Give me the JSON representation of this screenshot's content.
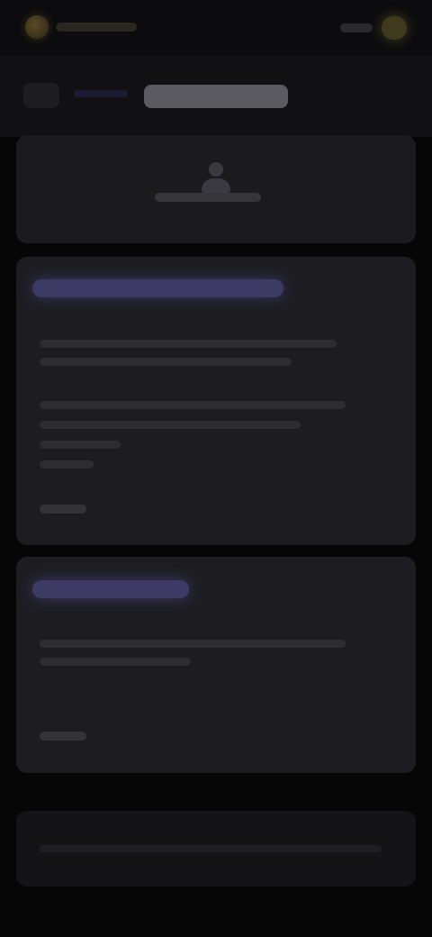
{
  "app": {
    "brand_name": "",
    "nav_link": "",
    "cta_label": ""
  },
  "header": {
    "back_label": "",
    "breadcrumb": "",
    "title": ""
  },
  "profile": {
    "name": ""
  },
  "cards": [
    {
      "heading": "",
      "lines": [
        "",
        "",
        "",
        "",
        "",
        ""
      ],
      "meta": ""
    },
    {
      "heading": "",
      "lines": [
        "",
        ""
      ],
      "meta": ""
    }
  ],
  "footer": {
    "text": ""
  },
  "colors": {
    "background": "#060607",
    "card": "#1d1d21",
    "accent_purple": "#3e3a66",
    "accent_gold": "#3f3a1e"
  },
  "icons": {
    "logo": "brand-logo-icon",
    "avatar": "user-avatar-icon"
  }
}
